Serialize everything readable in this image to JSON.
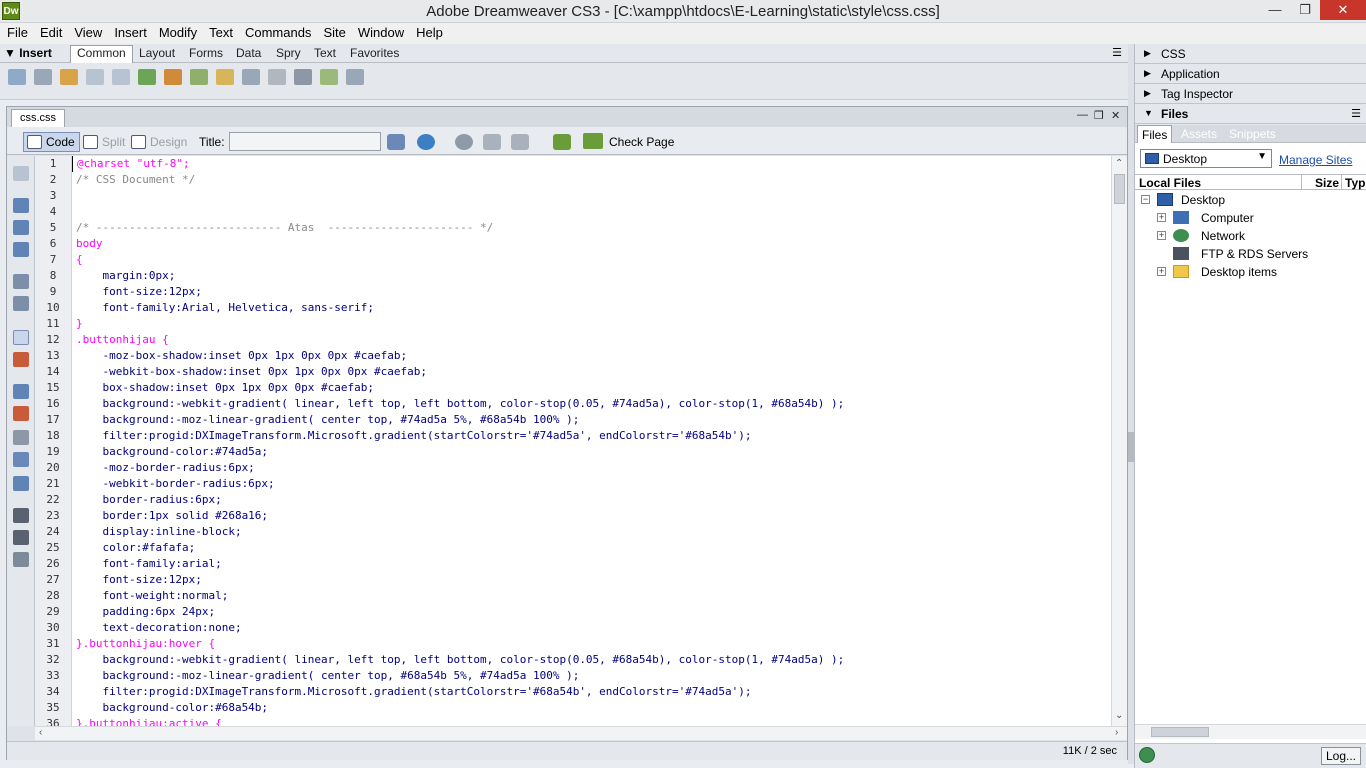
{
  "window": {
    "title": "Adobe Dreamweaver CS3 - [C:\\xampp\\htdocs\\E-Learning\\static\\style\\css.css]",
    "app_badge": "Dw"
  },
  "menu": [
    "File",
    "Edit",
    "View",
    "Insert",
    "Modify",
    "Text",
    "Commands",
    "Site",
    "Window",
    "Help"
  ],
  "insert_bar": {
    "label": "Insert",
    "tabs": [
      "Common",
      "Layout",
      "Forms",
      "Data",
      "Spry",
      "Text",
      "Favorites"
    ],
    "active_tab": "Common"
  },
  "document": {
    "tab": "css.css",
    "view_buttons": {
      "code": "Code",
      "split": "Split",
      "design": "Design"
    },
    "title_label": "Title:",
    "title_value": "",
    "check_page": "Check Page",
    "status": "11K / 2 sec"
  },
  "code_lines": [
    "@charset \"utf-8\";",
    "/* CSS Document */",
    "",
    "",
    "/* ---------------------------- Atas  ---------------------- */",
    "body",
    "{",
    "    margin:0px;",
    "    font-size:12px;",
    "    font-family:Arial, Helvetica, sans-serif;",
    "}",
    ".buttonhijau {",
    "    -moz-box-shadow:inset 0px 1px 0px 0px #caefab;",
    "    -webkit-box-shadow:inset 0px 1px 0px 0px #caefab;",
    "    box-shadow:inset 0px 1px 0px 0px #caefab;",
    "    background:-webkit-gradient( linear, left top, left bottom, color-stop(0.05, #74ad5a), color-stop(1, #68a54b) );",
    "    background:-moz-linear-gradient( center top, #74ad5a 5%, #68a54b 100% );",
    "    filter:progid:DXImageTransform.Microsoft.gradient(startColorstr='#74ad5a', endColorstr='#68a54b');",
    "    background-color:#74ad5a;",
    "    -moz-border-radius:6px;",
    "    -webkit-border-radius:6px;",
    "    border-radius:6px;",
    "    border:1px solid #268a16;",
    "    display:inline-block;",
    "    color:#fafafa;",
    "    font-family:arial;",
    "    font-size:12px;",
    "    font-weight:normal;",
    "    padding:6px 24px;",
    "    text-decoration:none;",
    "}.buttonhijau:hover {",
    "    background:-webkit-gradient( linear, left top, left bottom, color-stop(0.05, #68a54b), color-stop(1, #74ad5a) );",
    "    background:-moz-linear-gradient( center top, #68a54b 5%, #74ad5a 100% );",
    "    filter:progid:DXImageTransform.Microsoft.gradient(startColorstr='#68a54b', endColorstr='#74ad5a');",
    "    background-color:#68a54b;",
    "}.buttonhijau:active {"
  ],
  "panels": {
    "groups": [
      "CSS",
      "Application",
      "Tag Inspector",
      "Files"
    ],
    "files_tabs": [
      "Files",
      "Assets",
      "Snippets"
    ],
    "site_select": "Desktop",
    "manage_sites": "Manage Sites",
    "columns": {
      "local": "Local Files",
      "size": "Size",
      "type": "Typ"
    },
    "tree": {
      "root": "Desktop",
      "children": [
        "Computer",
        "Network",
        "FTP & RDS Servers",
        "Desktop items"
      ]
    },
    "log_button": "Log..."
  }
}
